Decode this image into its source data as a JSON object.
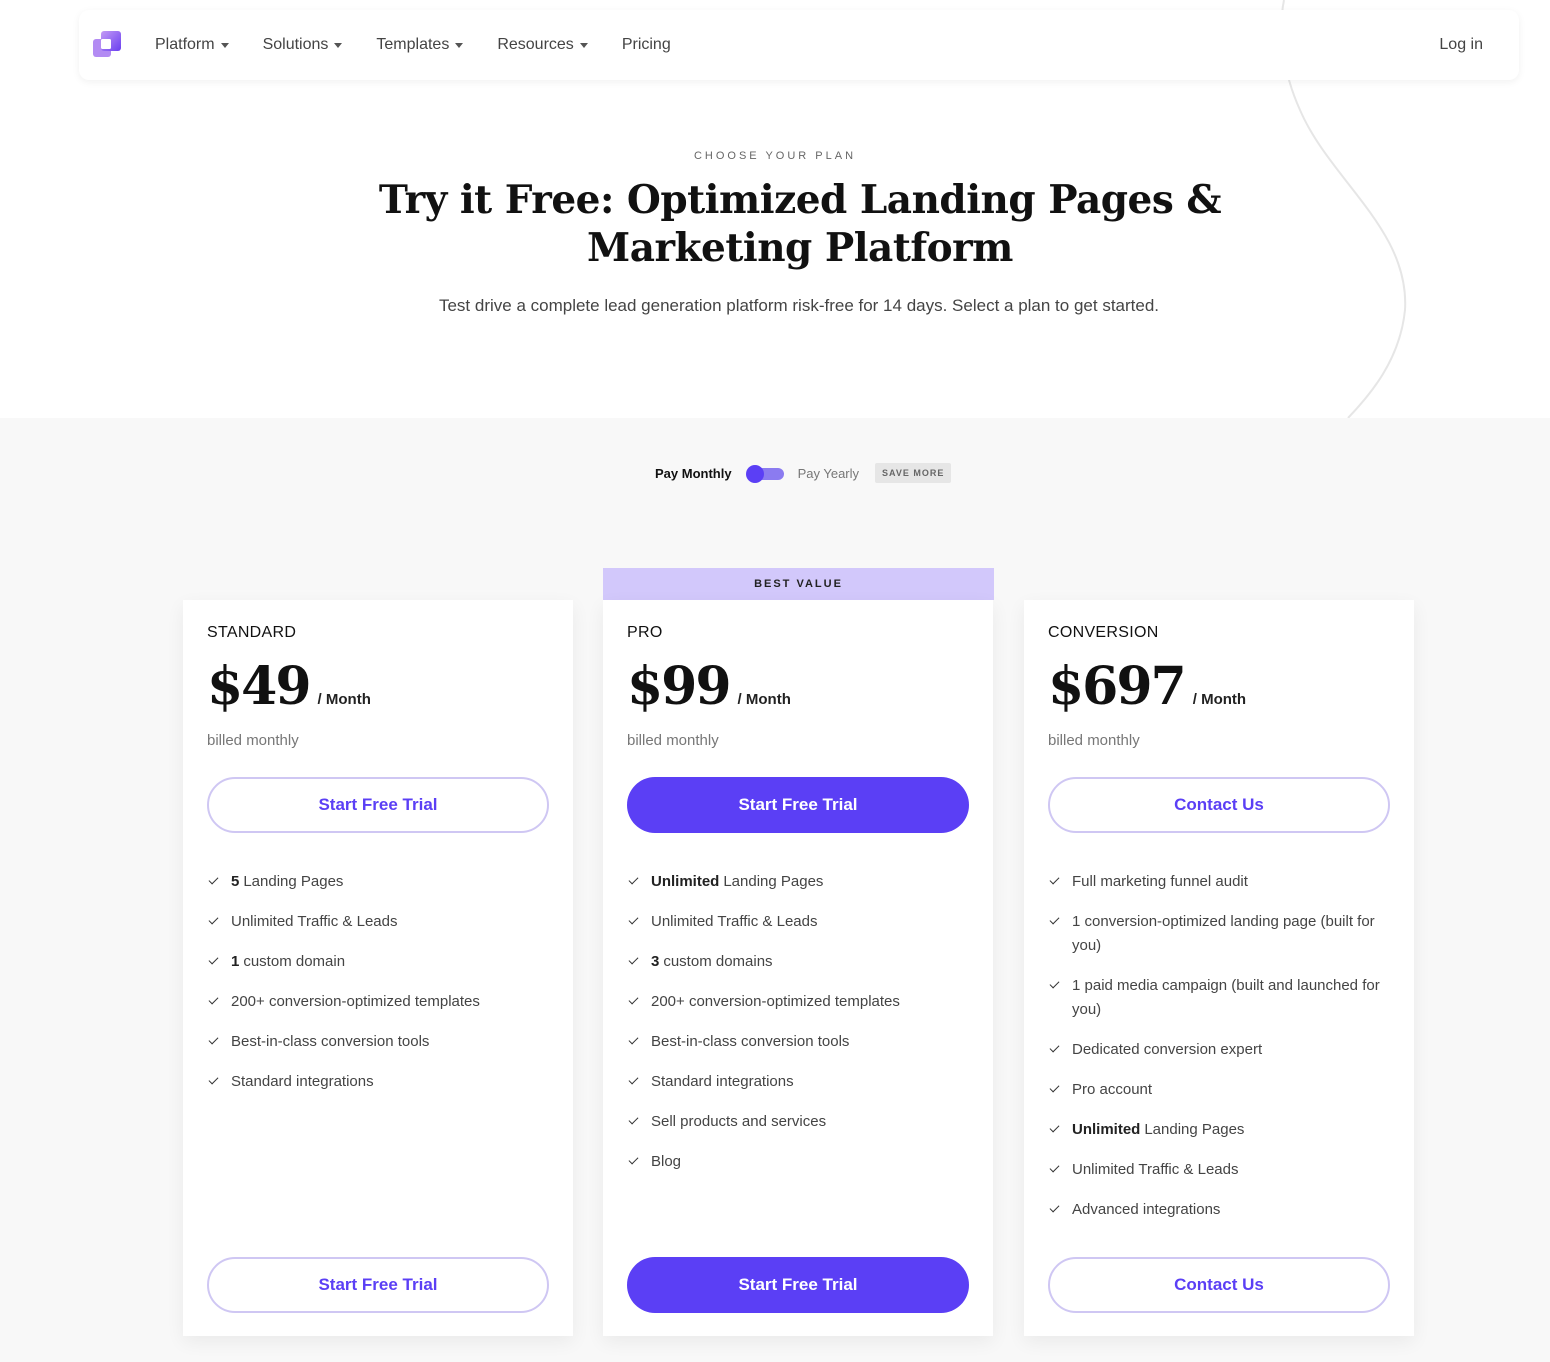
{
  "nav": {
    "items": [
      {
        "label": "Platform",
        "dropdown": true
      },
      {
        "label": "Solutions",
        "dropdown": true
      },
      {
        "label": "Templates",
        "dropdown": true
      },
      {
        "label": "Resources",
        "dropdown": true
      },
      {
        "label": "Pricing",
        "dropdown": false
      }
    ],
    "login": "Log in"
  },
  "hero": {
    "eyebrow": "CHOOSE YOUR PLAN",
    "headline": "Try it Free: Optimized Landing Pages & Marketing Platform",
    "subhead": "Test drive a complete lead generation platform risk-free for 14 days. Select a plan to get started."
  },
  "billing": {
    "monthly": "Pay Monthly",
    "yearly": "Pay Yearly",
    "badge": "SAVE MORE",
    "selected": "monthly"
  },
  "colors": {
    "accent": "#5b3ff5",
    "accent_light": "#d2c8fb",
    "outline": "#cfc7f3"
  },
  "plans": [
    {
      "name": "STANDARD",
      "price": "$49",
      "per": "/ Month",
      "billed": "billed monthly",
      "cta": "Start Free Trial",
      "cta_style": "outline",
      "features": [
        {
          "bold": "5",
          "text": "Landing Pages"
        },
        {
          "bold": "",
          "text": "Unlimited Traffic & Leads"
        },
        {
          "bold": "1",
          "text": "custom domain"
        },
        {
          "bold": "",
          "text": "200+ conversion-optimized templates"
        },
        {
          "bold": "",
          "text": "Best-in-class conversion tools"
        },
        {
          "bold": "",
          "text": "Standard integrations"
        }
      ]
    },
    {
      "name": "PRO",
      "badge": "BEST VALUE",
      "price": "$99",
      "per": "/ Month",
      "billed": "billed monthly",
      "cta": "Start Free Trial",
      "cta_style": "solid",
      "features": [
        {
          "bold": "Unlimited",
          "text": "Landing Pages"
        },
        {
          "bold": "",
          "text": "Unlimited Traffic & Leads"
        },
        {
          "bold": "3",
          "text": "custom domains"
        },
        {
          "bold": "",
          "text": "200+ conversion-optimized templates"
        },
        {
          "bold": "",
          "text": "Best-in-class conversion tools"
        },
        {
          "bold": "",
          "text": "Standard integrations"
        },
        {
          "bold": "",
          "text": "Sell products and services"
        },
        {
          "bold": "",
          "text": "Blog"
        }
      ]
    },
    {
      "name": "CONVERSION",
      "price": "$697",
      "per": "/ Month",
      "billed": "billed monthly",
      "cta": "Contact Us",
      "cta_style": "outline",
      "features": [
        {
          "bold": "",
          "text": "Full marketing funnel audit"
        },
        {
          "bold": "",
          "text": "1 conversion-optimized landing page (built for you)"
        },
        {
          "bold": "",
          "text": "1 paid media campaign (built and launched for you)"
        },
        {
          "bold": "",
          "text": "Dedicated conversion expert"
        },
        {
          "bold": "",
          "text": "Pro account"
        },
        {
          "bold": "Unlimited",
          "text": "Landing Pages"
        },
        {
          "bold": "",
          "text": "Unlimited Traffic & Leads"
        },
        {
          "bold": "",
          "text": "Advanced integrations"
        }
      ]
    }
  ]
}
